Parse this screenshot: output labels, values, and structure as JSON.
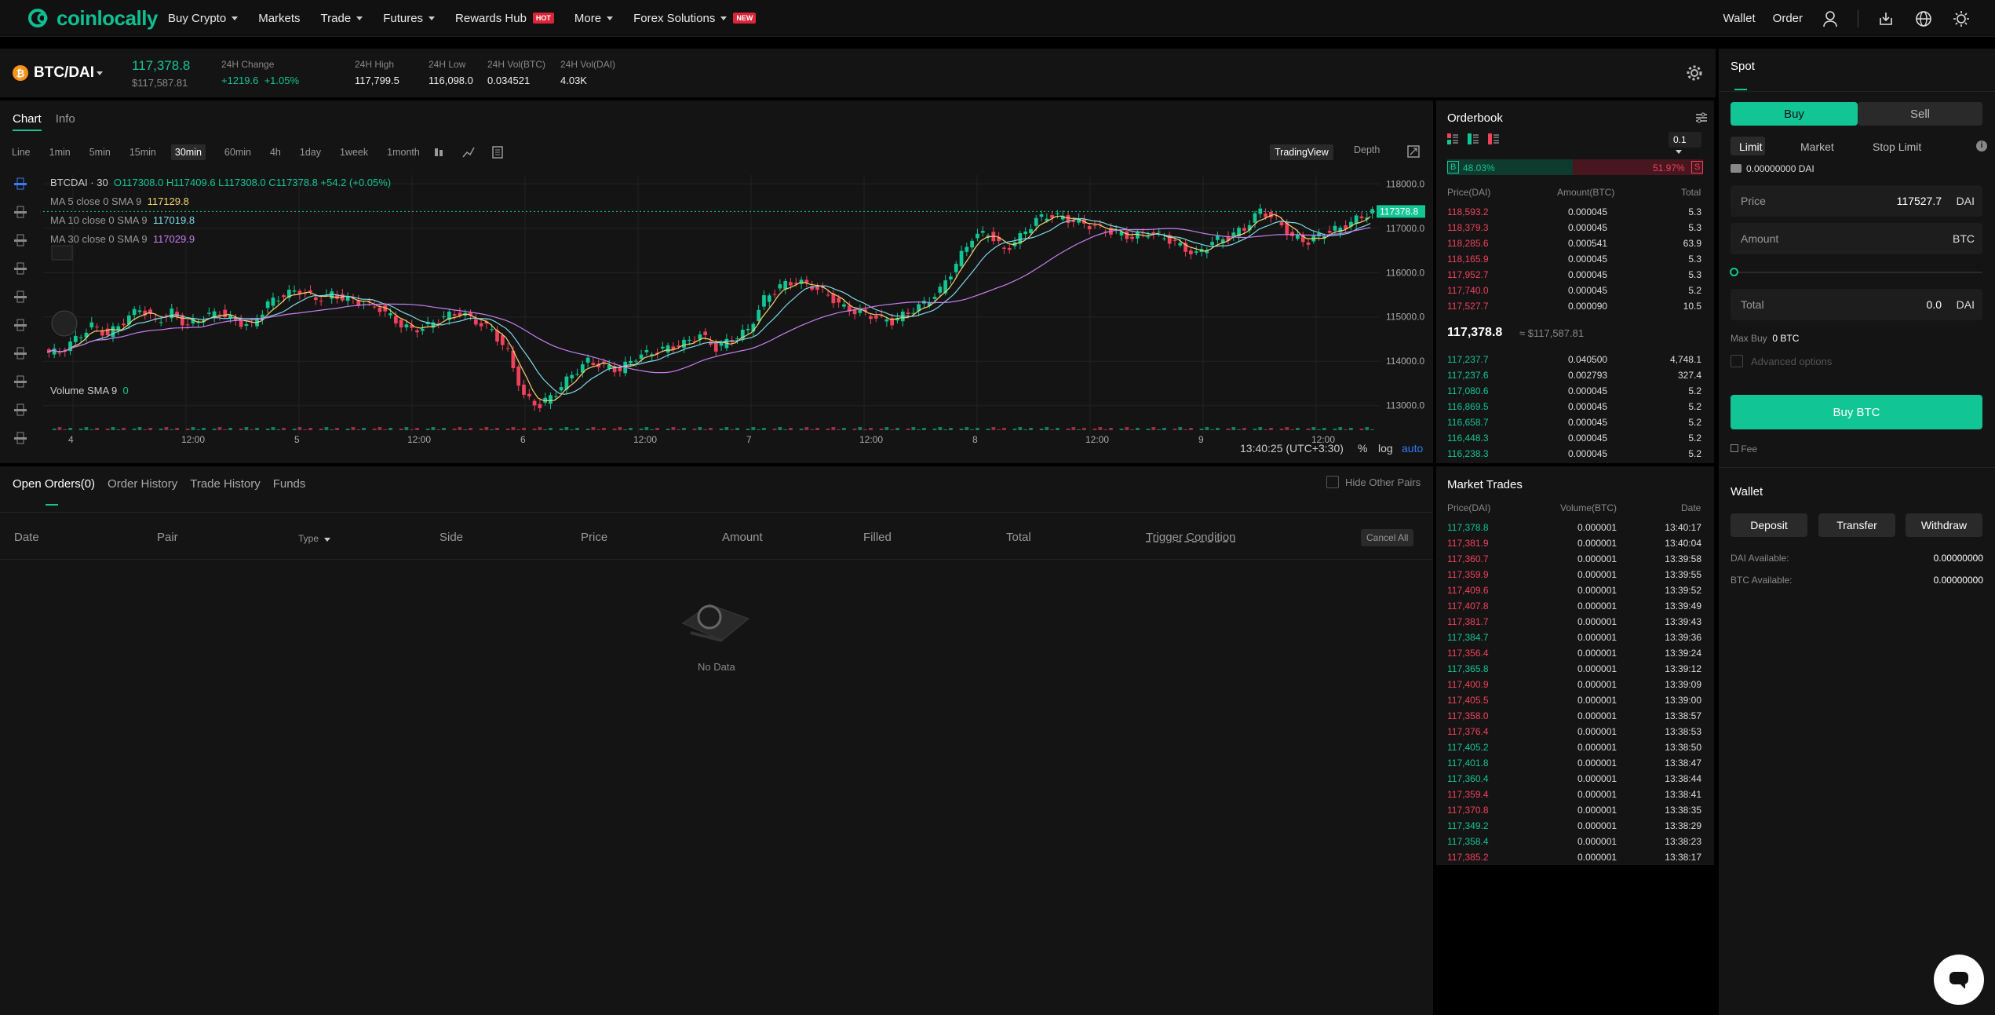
{
  "nav": {
    "logo_text": "coinlocally",
    "menu": [
      {
        "label": "Buy Crypto",
        "caret": true
      },
      {
        "label": "Markets",
        "caret": false
      },
      {
        "label": "Trade",
        "caret": true
      },
      {
        "label": "Futures",
        "caret": true
      },
      {
        "label": "Rewards Hub",
        "badge": "HOT"
      },
      {
        "label": "More",
        "caret": true
      },
      {
        "label": "Forex Solutions",
        "caret": true,
        "badge": "NEW"
      }
    ],
    "wallet": "Wallet",
    "order": "Order"
  },
  "pair": {
    "name": "BTC/DAI",
    "price": "117,378.8",
    "price_usd": "$117,587.81",
    "change_label": "24H Change",
    "change_abs": "+1219.6",
    "change_pct": "+1.05%",
    "high_label": "24H High",
    "high": "117,799.5",
    "low_label": "24H Low",
    "low": "116,098.0",
    "volbtc_label": "24H Vol(BTC)",
    "volbtc": "0.034521",
    "voldai_label": "24H Vol(DAI)",
    "voldai": "4.03K"
  },
  "chart": {
    "tabs": [
      "Chart",
      "Info"
    ],
    "intervals": [
      "Line",
      "1min",
      "5min",
      "15min",
      "30min",
      "60min",
      "4h",
      "1day",
      "1week",
      "1month"
    ],
    "active_interval": "30min",
    "views": [
      "TradingView",
      "Depth"
    ],
    "legend_symbol": "BTCDAI · 30",
    "ohlc": "O117308.0 H117409.6 L117308.0 C117378.8 +54.2 (+0.05%)",
    "ma5_label": "MA 5 close 0 SMA 9",
    "ma5": "117129.8",
    "ma10_label": "MA 10 close 0 SMA 9",
    "ma10": "117019.8",
    "ma30_label": "MA 30 close 0 SMA 9",
    "ma30": "117029.9",
    "vol_label": "Volume SMA 9",
    "vol_value": "0",
    "y_ticks": [
      "118000.0",
      "117000.0",
      "116000.0",
      "115000.0",
      "114000.0",
      "113000.0"
    ],
    "x_ticks": [
      "4",
      "12:00",
      "5",
      "12:00",
      "6",
      "12:00",
      "7",
      "12:00",
      "8",
      "12:00",
      "9",
      "12:00"
    ],
    "last_price_tag": "117378.8",
    "time": "13:40:25 (UTC+3:30)",
    "pct": "%",
    "log": "log",
    "auto": "auto"
  },
  "chart_data": {
    "type": "candlestick",
    "y_range": [
      112800,
      118200
    ],
    "close_series": [
      114200,
      114500,
      114800,
      114600,
      114900,
      115200,
      114900,
      115100,
      114800,
      115000,
      115100,
      114900,
      114800,
      115300,
      115500,
      115600,
      115400,
      115500,
      115400,
      115300,
      115200,
      114900,
      114700,
      114800,
      115000,
      115100,
      114900,
      114700,
      114200,
      113200,
      113000,
      113300,
      113700,
      114000,
      113900,
      113800,
      114100,
      114200,
      114300,
      114400,
      114600,
      114300,
      114500,
      114700,
      115400,
      115700,
      115800,
      115700,
      115500,
      115200,
      115100,
      115000,
      114900,
      115100,
      115300,
      115600,
      116200,
      116800,
      116900,
      116500,
      116800,
      117200,
      117300,
      117200,
      117100,
      117000,
      116900,
      116800,
      116900,
      116800,
      116600,
      116400,
      116700,
      116800,
      117000,
      117400,
      117200,
      116800,
      116700,
      116900,
      117000,
      117200,
      117378.8
    ]
  },
  "orderbook": {
    "title": "Orderbook",
    "step": "0.1",
    "buy_pct": "48.03%",
    "sell_pct": "51.97%",
    "buy_letter": "B",
    "sell_letter": "S",
    "headers": [
      "Price(DAI)",
      "Amount(BTC)",
      "Total"
    ],
    "asks": [
      [
        "118,593.2",
        "0.000045",
        "5.3"
      ],
      [
        "118,379.3",
        "0.000045",
        "5.3"
      ],
      [
        "118,285.6",
        "0.000541",
        "63.9"
      ],
      [
        "118,165.9",
        "0.000045",
        "5.3"
      ],
      [
        "117,952.7",
        "0.000045",
        "5.3"
      ],
      [
        "117,740.0",
        "0.000045",
        "5.2"
      ],
      [
        "117,527.7",
        "0.000090",
        "10.5"
      ]
    ],
    "last": "117,378.8",
    "last_usd": "≈ $117,587.81",
    "bids": [
      [
        "117,237.7",
        "0.040500",
        "4,748.1"
      ],
      [
        "117,237.6",
        "0.002793",
        "327.4"
      ],
      [
        "117,080.6",
        "0.000045",
        "5.2"
      ],
      [
        "116,869.5",
        "0.000045",
        "5.2"
      ],
      [
        "116,658.7",
        "0.000045",
        "5.2"
      ],
      [
        "116,448.3",
        "0.000045",
        "5.2"
      ],
      [
        "116,238.3",
        "0.000045",
        "5.2"
      ]
    ]
  },
  "trades": {
    "title": "Market Trades",
    "headers": [
      "Price(DAI)",
      "Volume(BTC)",
      "Date"
    ],
    "rows": [
      [
        "117,378.8",
        "0.000001",
        "13:40:17",
        "buy"
      ],
      [
        "117,381.9",
        "0.000001",
        "13:40:04",
        "sell"
      ],
      [
        "117,360.7",
        "0.000001",
        "13:39:58",
        "sell"
      ],
      [
        "117,359.9",
        "0.000001",
        "13:39:55",
        "sell"
      ],
      [
        "117,409.6",
        "0.000001",
        "13:39:52",
        "sell"
      ],
      [
        "117,407.8",
        "0.000001",
        "13:39:49",
        "sell"
      ],
      [
        "117,381.7",
        "0.000001",
        "13:39:43",
        "sell"
      ],
      [
        "117,384.7",
        "0.000001",
        "13:39:36",
        "buy"
      ],
      [
        "117,356.4",
        "0.000001",
        "13:39:24",
        "sell"
      ],
      [
        "117,365.8",
        "0.000001",
        "13:39:12",
        "buy"
      ],
      [
        "117,400.9",
        "0.000001",
        "13:39:09",
        "sell"
      ],
      [
        "117,405.5",
        "0.000001",
        "13:39:00",
        "sell"
      ],
      [
        "117,358.0",
        "0.000001",
        "13:38:57",
        "sell"
      ],
      [
        "117,376.4",
        "0.000001",
        "13:38:53",
        "sell"
      ],
      [
        "117,405.2",
        "0.000001",
        "13:38:50",
        "buy"
      ],
      [
        "117,401.8",
        "0.000001",
        "13:38:47",
        "buy"
      ],
      [
        "117,360.4",
        "0.000001",
        "13:38:44",
        "buy"
      ],
      [
        "117,359.4",
        "0.000001",
        "13:38:41",
        "sell"
      ],
      [
        "117,370.8",
        "0.000001",
        "13:38:35",
        "sell"
      ],
      [
        "117,349.2",
        "0.000001",
        "13:38:29",
        "buy"
      ],
      [
        "117,358.4",
        "0.000001",
        "13:38:23",
        "buy"
      ],
      [
        "117,385.2",
        "0.000001",
        "13:38:17",
        "sell"
      ]
    ]
  },
  "orders": {
    "tabs": [
      "Open Orders(0)",
      "Order History",
      "Trade History",
      "Funds"
    ],
    "hide_pairs": "Hide Other Pairs",
    "columns": [
      "Date",
      "Pair",
      "Type",
      "Side",
      "Price",
      "Amount",
      "Filled",
      "Total",
      "Trigger Condition"
    ],
    "cancel_all": "Cancel All",
    "empty": "No Data"
  },
  "spot": {
    "title": "Spot",
    "buy": "Buy",
    "sell": "Sell",
    "order_types": [
      "Limit",
      "Market",
      "Stop Limit"
    ],
    "balance": "0.00000000 DAI",
    "price_label": "Price",
    "price_value": "117527.7",
    "price_unit": "DAI",
    "amount_label": "Amount",
    "amount_unit": "BTC",
    "total_label": "Total",
    "total_value": "0.0",
    "total_unit": "DAI",
    "max_buy_label": "Max Buy",
    "max_buy": "0 BTC",
    "advanced": "Advanced options",
    "buy_button": "Buy BTC",
    "fee": "Fee",
    "wallet_title": "Wallet",
    "deposit": "Deposit",
    "transfer": "Transfer",
    "withdraw": "Withdraw",
    "dai_avail_label": "DAI Available:",
    "dai_avail": "0.00000000",
    "btc_avail_label": "BTC Available:",
    "btc_avail": "0.00000000"
  },
  "colors": {
    "accent": "#12c594",
    "down": "#f0415b",
    "bg": "#141414"
  }
}
